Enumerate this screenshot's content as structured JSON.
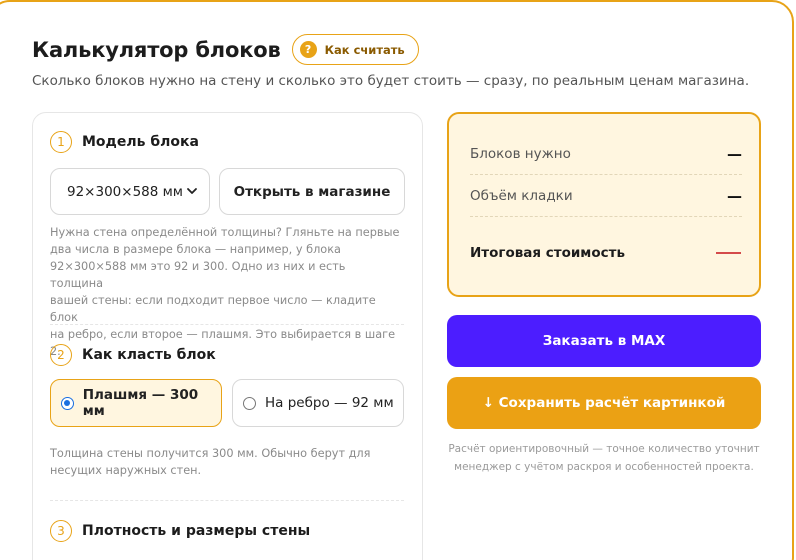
{
  "header": {
    "title": "Калькулятор блоков",
    "how_label": "Как считать",
    "how_icon": "?",
    "subtitle": "Сколько блоков нужно на стену и сколько это будет стоить — сразу, по реальным ценам магазина."
  },
  "steps": [
    {
      "num": "1",
      "title": "Модель блока",
      "select_value": "92×300×588 мм",
      "shop_button": "Открыть в магазине",
      "hint_lines": [
        "Нужна стена определённой толщины? Гляньте на первые",
        "два числа в размере блока — например, у блока",
        "92×300×588 мм это 92 и 300. Одно из них и есть толщина",
        "вашей стены: если подходит первое число — кладите блок",
        "на ребро, если второе — плашмя. Это выбирается в шаге 2."
      ]
    },
    {
      "num": "2",
      "title": "Как класть блок",
      "options": [
        {
          "label": "Плашмя — 300 мм",
          "selected": true
        },
        {
          "label": "На ребро — 92 мм",
          "selected": false
        }
      ],
      "hint_lines": [
        "Толщина стены получится 300 мм. Обычно берут для",
        "несущих наружных стен."
      ]
    },
    {
      "num": "3",
      "title": "Плотность и размеры стены"
    }
  ],
  "result": {
    "blocks_label": "Блоков нужно",
    "blocks_value": "—",
    "volume_label": "Объём кладки",
    "volume_value": "—",
    "total_label": "Итоговая стоимость"
  },
  "actions": {
    "order_label": "Заказать в MAX",
    "save_label": "↓ Сохранить расчёт картинкой"
  },
  "note_lines": [
    "Расчёт ориентировочный — точное количество уточнит",
    "менеджер с учётом раскроя и особенностей проекта."
  ],
  "colors": {
    "accent": "#e8a317",
    "accent_bg": "#fff6e0",
    "order_button": "#4c1dff",
    "save_button": "#eba114",
    "total_dash": "#d44a4a",
    "radio": "#1a6fe0"
  }
}
